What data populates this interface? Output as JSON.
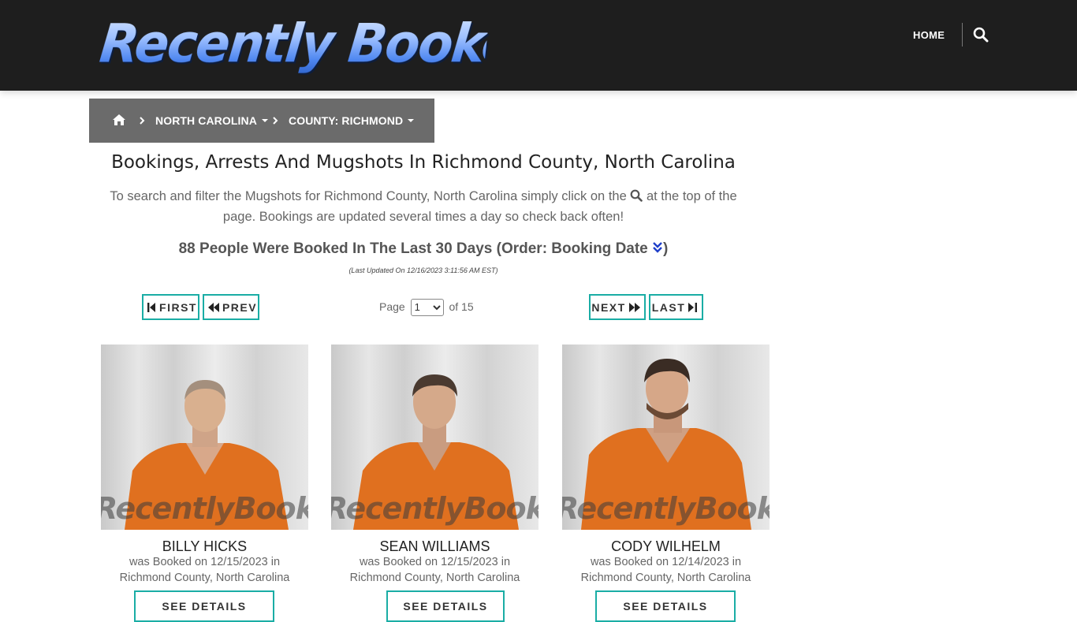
{
  "header": {
    "logo_text": "Recently Booked",
    "nav_home": "HOME"
  },
  "breadcrumb": {
    "state": "NORTH CAROLINA",
    "county": "COUNTY: RICHMOND"
  },
  "page": {
    "title": "Bookings, Arrests And Mugshots In Richmond County, North Carolina",
    "intro_part1": "To search and filter the Mugshots for Richmond County, North Carolina simply click on the",
    "intro_part2": "at the top of the page. Bookings are updated several times a day so check back often!",
    "count_text": "88 People Were Booked In The Last 30 Days (Order: Booking Date",
    "count_close": ")",
    "last_updated": "(Last Updated On 12/16/2023 3:11:56 AM EST)"
  },
  "pager": {
    "first": "FIRST",
    "prev": "PREV",
    "next": "NEXT",
    "last": "LAST",
    "page_label": "Page",
    "current_page": "1",
    "of_label": "of 15"
  },
  "watermark": "RecentlyBooked.com",
  "people": [
    {
      "name": "BILLY HICKS",
      "booked_line": "was Booked on 12/15/2023 in",
      "location": "Richmond County, North Carolina",
      "details_label": "SEE DETAILS"
    },
    {
      "name": "SEAN WILLIAMS",
      "booked_line": "was Booked on 12/15/2023 in",
      "location": "Richmond County, North Carolina",
      "details_label": "SEE DETAILS"
    },
    {
      "name": "CODY WILHELM",
      "booked_line": "was Booked on 12/14/2023 in",
      "location": "Richmond County, North Carolina",
      "details_label": "SEE DETAILS"
    }
  ],
  "colors": {
    "header_bg": "#1e1e1e",
    "breadcrumb_bg": "#6b6b6b",
    "button_border": "#1aada5",
    "uniform": "#e0701f"
  }
}
